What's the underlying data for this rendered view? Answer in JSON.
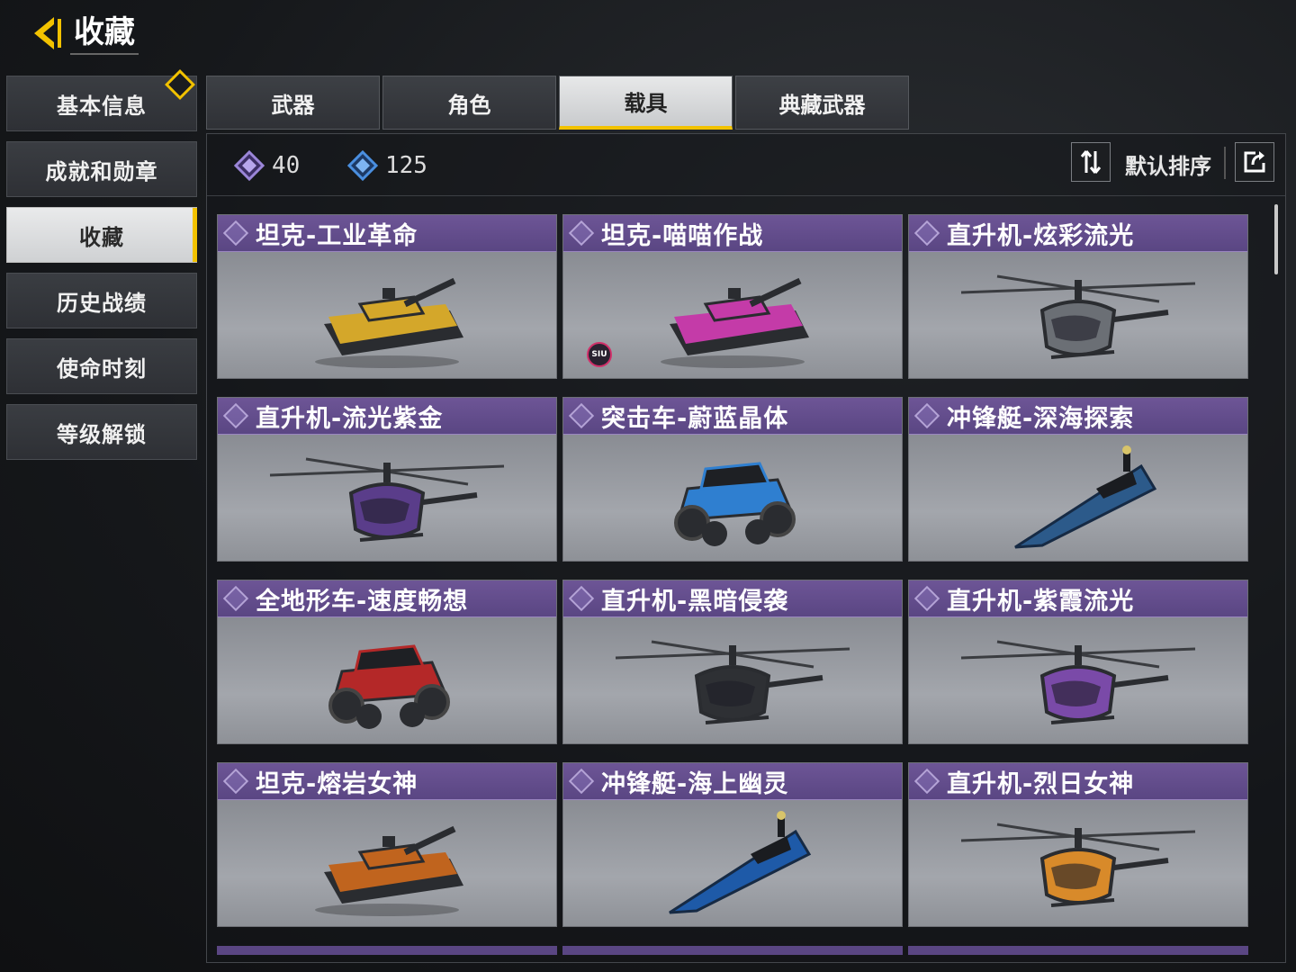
{
  "header": {
    "title": "收藏",
    "back_icon": "back-arrow-icon"
  },
  "sidebar": {
    "items": [
      {
        "label": "基本信息",
        "active": false,
        "notice": true
      },
      {
        "label": "成就和勋章",
        "active": false
      },
      {
        "label": "收藏",
        "active": true
      },
      {
        "label": "历史战绩",
        "active": false
      },
      {
        "label": "使命时刻",
        "active": false
      },
      {
        "label": "等级解锁",
        "active": false
      }
    ]
  },
  "tabs": [
    {
      "label": "武器",
      "active": false
    },
    {
      "label": "角色",
      "active": false
    },
    {
      "label": "载具",
      "active": true
    },
    {
      "label": "典藏武器",
      "active": false
    }
  ],
  "toolbar": {
    "currency_1": {
      "icon": "purple-diamond-icon",
      "amount": "40",
      "color": "#9b86d8"
    },
    "currency_2": {
      "icon": "blue-diamond-icon",
      "amount": "125",
      "color": "#4a8fe0"
    },
    "sort_label": "默认排序",
    "sort_icon": "sort-arrows-icon",
    "share_icon": "share-icon"
  },
  "items": [
    {
      "name": "坦克-工业革命",
      "kind": "tank",
      "color": "#d4a72a"
    },
    {
      "name": "坦克-喵喵作战",
      "kind": "tank",
      "color": "#c43ba8",
      "badge": "SIU"
    },
    {
      "name": "直升机-炫彩流光",
      "kind": "helicopter",
      "color": "#6b6f75"
    },
    {
      "name": "直升机-流光紫金",
      "kind": "helicopter",
      "color": "#5a3d8a"
    },
    {
      "name": "突击车-蔚蓝晶体",
      "kind": "buggy",
      "color": "#2f7fd0"
    },
    {
      "name": "冲锋艇-深海探索",
      "kind": "boat",
      "color": "#2c5a8a"
    },
    {
      "name": "全地形车-速度畅想",
      "kind": "atv",
      "color": "#b42828"
    },
    {
      "name": "直升机-黑暗侵袭",
      "kind": "helicopter",
      "color": "#2e3034"
    },
    {
      "name": "直升机-紫霞流光",
      "kind": "helicopter",
      "color": "#7a4aa8"
    },
    {
      "name": "坦克-熔岩女神",
      "kind": "tank",
      "color": "#c0641e"
    },
    {
      "name": "冲锋艇-海上幽灵",
      "kind": "boat",
      "color": "#1e5aa8"
    },
    {
      "name": "直升机-烈日女神",
      "kind": "helicopter",
      "color": "#d88a2a"
    }
  ]
}
